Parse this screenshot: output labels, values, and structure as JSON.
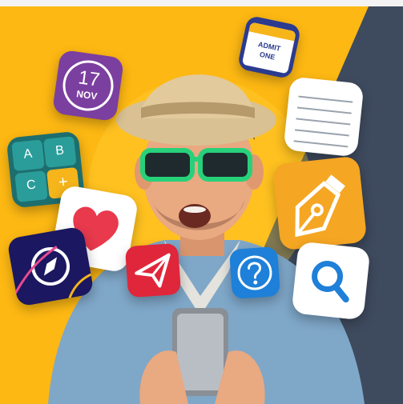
{
  "colors": {
    "yellow": "#FDB813",
    "navy": "#3E4A5E",
    "denim": "#7FA7C8",
    "skin": "#E9A981"
  },
  "icons": {
    "calendar": {
      "name": "calendar-icon",
      "day": "17",
      "month": "NOV",
      "color": "#7B3FA0"
    },
    "ticket": {
      "name": "ticket-icon",
      "line1": "ADMIT",
      "line2": "ONE"
    },
    "notepad": {
      "name": "notepad-icon"
    },
    "calculator": {
      "name": "calculator-icon",
      "keys": [
        "A",
        "B",
        "C",
        "+"
      ]
    },
    "health": {
      "name": "heart-icon"
    },
    "pen": {
      "name": "pen-nib-icon"
    },
    "compass": {
      "name": "compass-icon"
    },
    "send": {
      "name": "paper-plane-icon"
    },
    "help": {
      "name": "question-mark-icon"
    },
    "search": {
      "name": "search-icon"
    }
  }
}
